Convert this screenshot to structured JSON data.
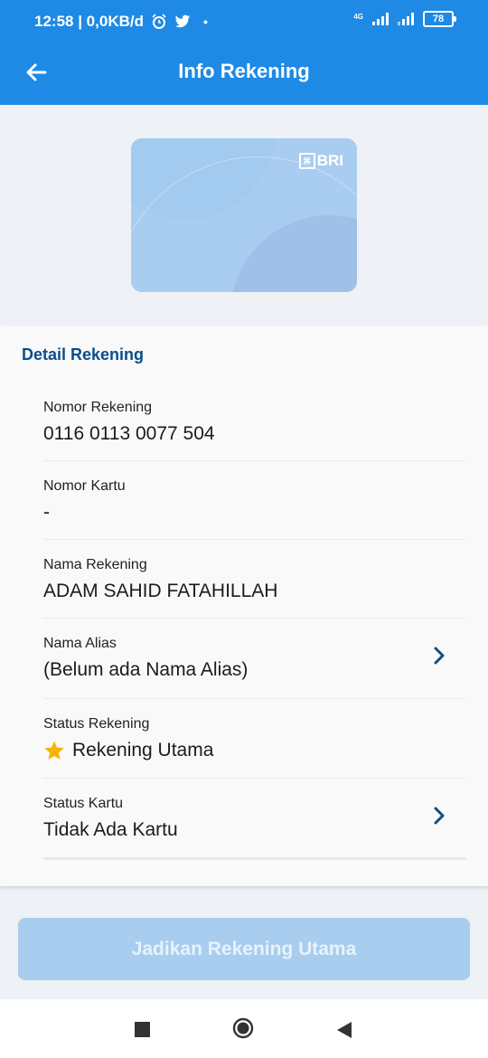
{
  "status_bar": {
    "time_speed": "12:58 | 0,0KB/d",
    "network": "4G",
    "battery": "78",
    "icons": [
      "alarm-icon",
      "twitter-icon",
      "dot-icon",
      "signal-icon",
      "battery-icon"
    ]
  },
  "header": {
    "title": "Info Rekening",
    "back_icon": "arrow-left-icon"
  },
  "card": {
    "brand": "BRI",
    "colors": {
      "card": "#a9cdf0"
    }
  },
  "detail": {
    "section_title": "Detail Rekening",
    "rows": [
      {
        "label": "Nomor Rekening",
        "value": "0116 0113 0077 504"
      },
      {
        "label": "Nomor Kartu",
        "value": "-"
      },
      {
        "label": "Nama Rekening",
        "value": "ADAM SAHID FATAHILLAH"
      },
      {
        "label": "Nama Alias",
        "value": "(Belum ada Nama Alias)"
      },
      {
        "label": "Status Rekening",
        "value": "Rekening Utama"
      },
      {
        "label": "Status Kartu",
        "value": "Tidak Ada Kartu"
      }
    ]
  },
  "cta": {
    "label": "Jadikan Rekening Utama"
  },
  "colors": {
    "primary": "#1f8ae5",
    "section_title": "#0a4d8c",
    "button_disabled": "#a8cdef",
    "star": "#f5b400"
  },
  "nav_bar": {
    "icons": [
      "recents-icon",
      "home-icon",
      "back-icon"
    ]
  }
}
